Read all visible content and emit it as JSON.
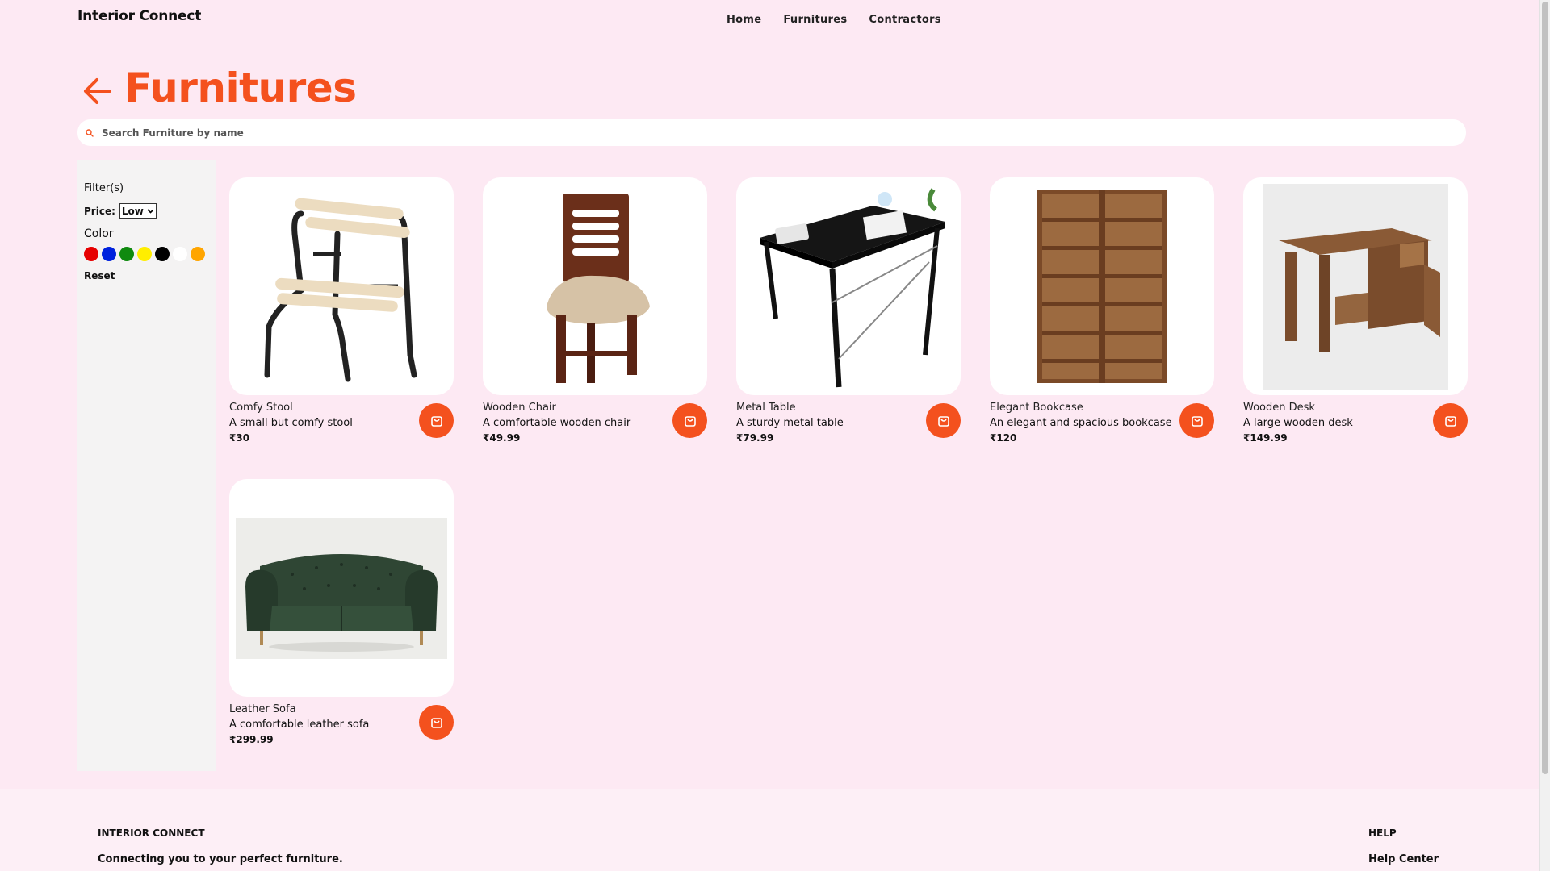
{
  "header": {
    "brand": "Interior Connect",
    "nav": [
      "Home",
      "Furnitures",
      "Contractors"
    ]
  },
  "page": {
    "title": "Furnitures"
  },
  "search": {
    "placeholder": "Search Furniture by name",
    "value": ""
  },
  "filters": {
    "heading": "Filter(s)",
    "price_label": "Price:",
    "price_selected": "Low",
    "color_label": "Color",
    "colors": [
      "#e60000",
      "#0022dd",
      "#0f8a0f",
      "#ffee00",
      "#000000",
      "#ffffff",
      "#ffa500"
    ],
    "reset_label": "Reset"
  },
  "products": [
    {
      "name": "Comfy Stool",
      "description": "A small but comfy stool",
      "price": "₹30",
      "icon": "stool-image"
    },
    {
      "name": "Wooden Chair",
      "description": "A comfortable wooden chair",
      "price": "₹49.99",
      "icon": "chair-image"
    },
    {
      "name": "Metal Table",
      "description": "A sturdy metal table",
      "price": "₹79.99",
      "icon": "table-image"
    },
    {
      "name": "Elegant Bookcase",
      "description": "An elegant and spacious bookcase",
      "price": "₹120",
      "icon": "bookcase-image"
    },
    {
      "name": "Wooden Desk",
      "description": "A large wooden desk",
      "price": "₹149.99",
      "icon": "desk-image"
    },
    {
      "name": "Leather Sofa",
      "description": "A comfortable leather sofa",
      "price": "₹299.99",
      "icon": "sofa-image"
    }
  ],
  "footer": {
    "brand": "INTERIOR CONNECT",
    "tagline": "Connecting you to your perfect furniture.",
    "help_heading": "HELP",
    "help_link": "Help Center"
  },
  "colors": {
    "accent": "#f4511e",
    "background": "#fde9f3",
    "sidebar": "#f4f3f3"
  }
}
